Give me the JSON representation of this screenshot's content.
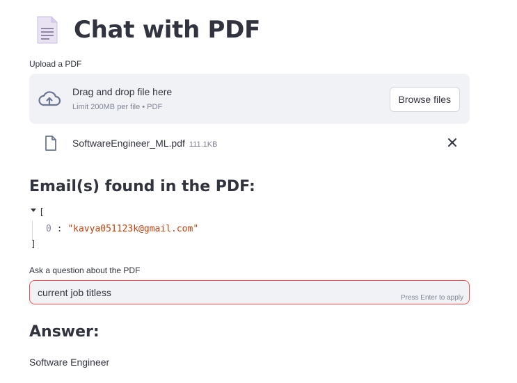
{
  "page": {
    "title": "Chat with PDF",
    "icon": "document-icon"
  },
  "uploader": {
    "label": "Upload a PDF",
    "drop_title": "Drag and drop file here",
    "drop_subtitle": "Limit 200MB per file • PDF",
    "browse_label": "Browse files",
    "upload_icon": "cloud-upload-icon"
  },
  "uploaded_file": {
    "name": "SoftwareEngineer_ML.pdf",
    "size": "111.1KB",
    "icon": "file-icon",
    "remove_icon": "close-icon"
  },
  "emails_section": {
    "heading": "Email(s) found in the PDF:",
    "json_open": "[",
    "json_close": "]",
    "items": [
      {
        "index": "0",
        "value": "\"kavya051123k@gmail.com\""
      }
    ]
  },
  "question": {
    "label": "Ask a question about the PDF",
    "value": "current job titless",
    "hint": "Press Enter to apply"
  },
  "answer_section": {
    "heading": "Answer:",
    "text": "Software Engineer"
  },
  "colors": {
    "accent": "#ff4b4b",
    "surface": "#f0f2f6",
    "text": "#31333f",
    "muted": "#808495",
    "json_string": "#c2410c"
  }
}
